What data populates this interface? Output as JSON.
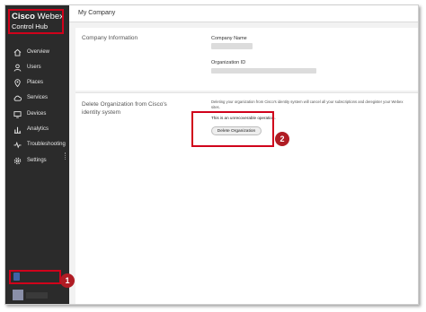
{
  "brand": {
    "name_bold": "Cisco",
    "name_light": "Webex",
    "product": "Control Hub"
  },
  "sidebar": {
    "items": [
      {
        "label": "Overview",
        "icon": "home-icon"
      },
      {
        "label": "Users",
        "icon": "user-icon"
      },
      {
        "label": "Places",
        "icon": "location-pin-icon"
      },
      {
        "label": "Services",
        "icon": "cloud-icon"
      },
      {
        "label": "Devices",
        "icon": "monitor-icon"
      },
      {
        "label": "Analytics",
        "icon": "bar-chart-icon"
      },
      {
        "label": "Troubleshooting",
        "icon": "pulse-icon"
      },
      {
        "label": "Settings",
        "icon": "gear-icon"
      }
    ]
  },
  "header": {
    "title": "My Company"
  },
  "company_info": {
    "section_title": "Company Information",
    "name_label": "Company Name",
    "org_id_label": "Organization ID"
  },
  "delete_org": {
    "section_title": "Delete Organization from Cisco's identity system",
    "description": "Deleting your organization from Cisco's identity system will cancel all your subscriptions and deregister your Webex sites.",
    "warning": "This is an unrecoverable operation.",
    "button_label": "Delete Organization"
  },
  "annotations": {
    "badge1": "1",
    "badge2": "2"
  },
  "colors": {
    "sidebar_bg": "#2b2b2b",
    "highlight": "#d0021b",
    "badge": "#b01c24"
  }
}
